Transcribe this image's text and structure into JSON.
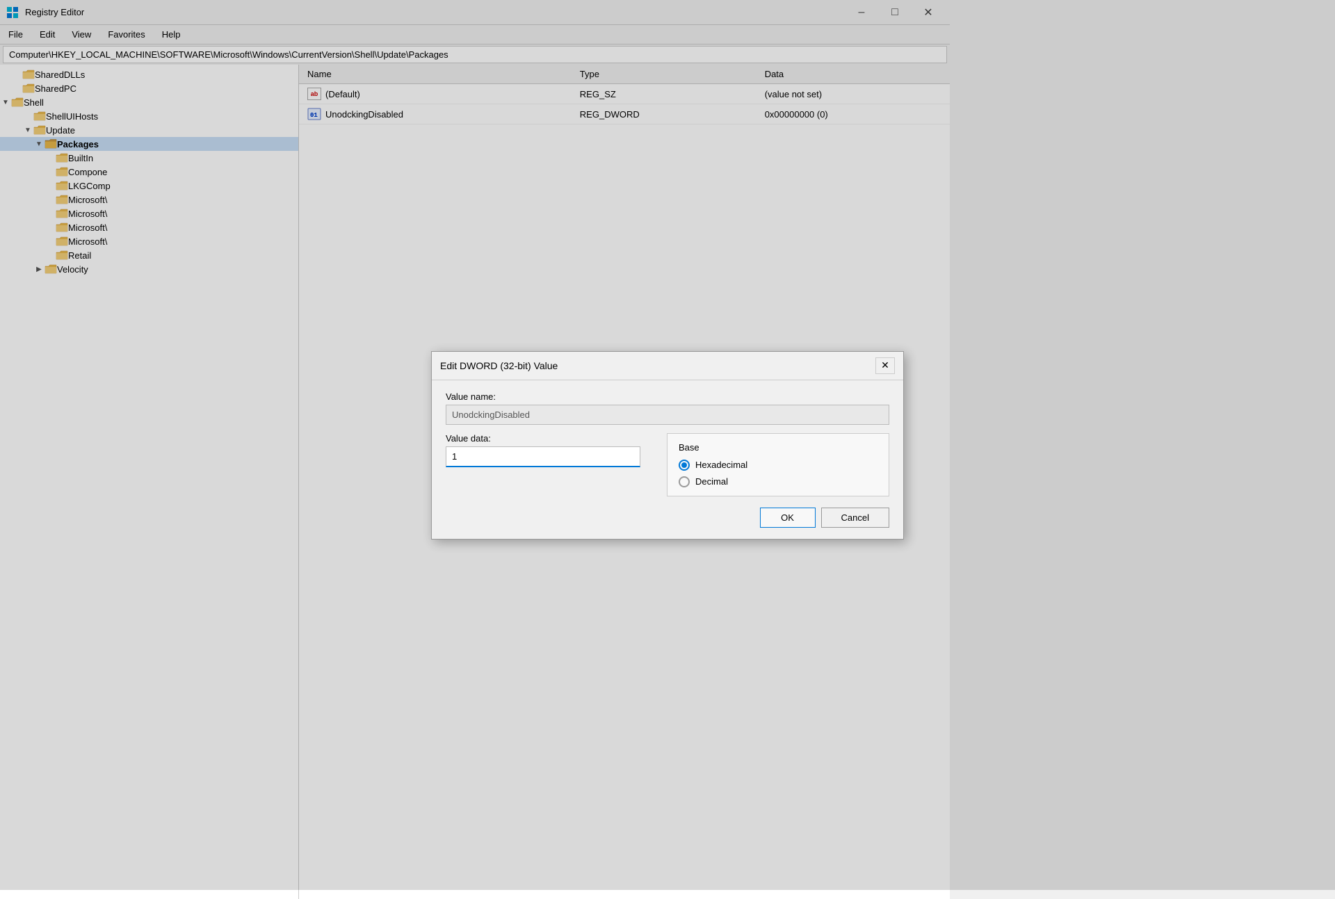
{
  "titleBar": {
    "icon": "regedit",
    "title": "Registry Editor",
    "minimizeLabel": "–",
    "maximizeLabel": "□",
    "closeLabel": "✕"
  },
  "menuBar": {
    "items": [
      "File",
      "Edit",
      "View",
      "Favorites",
      "Help"
    ]
  },
  "addressBar": {
    "path": "Computer\\HKEY_LOCAL_MACHINE\\SOFTWARE\\Microsoft\\Windows\\CurrentVersion\\Shell\\Update\\Packages"
  },
  "treePanel": {
    "items": [
      {
        "label": "SharedDLLs",
        "indent": 1,
        "expanded": false,
        "hasChildren": false
      },
      {
        "label": "SharedPC",
        "indent": 1,
        "expanded": false,
        "hasChildren": false
      },
      {
        "label": "Shell",
        "indent": 1,
        "expanded": true,
        "hasChildren": true
      },
      {
        "label": "ShellUIHosts",
        "indent": 2,
        "expanded": false,
        "hasChildren": false
      },
      {
        "label": "Update",
        "indent": 2,
        "expanded": true,
        "hasChildren": true
      },
      {
        "label": "Packages",
        "indent": 3,
        "expanded": true,
        "hasChildren": true,
        "selected": true
      },
      {
        "label": "BuiltIn",
        "indent": 4,
        "expanded": false,
        "hasChildren": false
      },
      {
        "label": "Compone",
        "indent": 4,
        "expanded": false,
        "hasChildren": false
      },
      {
        "label": "LKGComp",
        "indent": 4,
        "expanded": false,
        "hasChildren": false
      },
      {
        "label": "Microsoft\\",
        "indent": 4,
        "expanded": false,
        "hasChildren": false
      },
      {
        "label": "Microsoft\\",
        "indent": 4,
        "expanded": false,
        "hasChildren": false
      },
      {
        "label": "Microsoft\\",
        "indent": 4,
        "expanded": false,
        "hasChildren": false
      },
      {
        "label": "Microsoft\\",
        "indent": 4,
        "expanded": false,
        "hasChildren": false
      },
      {
        "label": "Retail",
        "indent": 4,
        "expanded": false,
        "hasChildren": false
      },
      {
        "label": "Velocity",
        "indent": 3,
        "expanded": false,
        "hasChildren": true
      }
    ]
  },
  "registryTable": {
    "columns": [
      "Name",
      "Type",
      "Data"
    ],
    "rows": [
      {
        "name": "(Default)",
        "type": "REG_SZ",
        "data": "(value not set)",
        "iconType": "ab"
      },
      {
        "name": "UnodckingDisabled",
        "type": "REG_DWORD",
        "data": "0x00000000 (0)",
        "iconType": "dword"
      }
    ]
  },
  "dialog": {
    "title": "Edit DWORD (32-bit) Value",
    "valueNameLabel": "Value name:",
    "valueNameValue": "UnodckingDisabled",
    "valueDataLabel": "Value data:",
    "valueDataValue": "1",
    "baseLabel": "Base",
    "hexadecimalLabel": "Hexadecimal",
    "decimalLabel": "Decimal",
    "hexSelected": true,
    "okLabel": "OK",
    "cancelLabel": "Cancel"
  }
}
